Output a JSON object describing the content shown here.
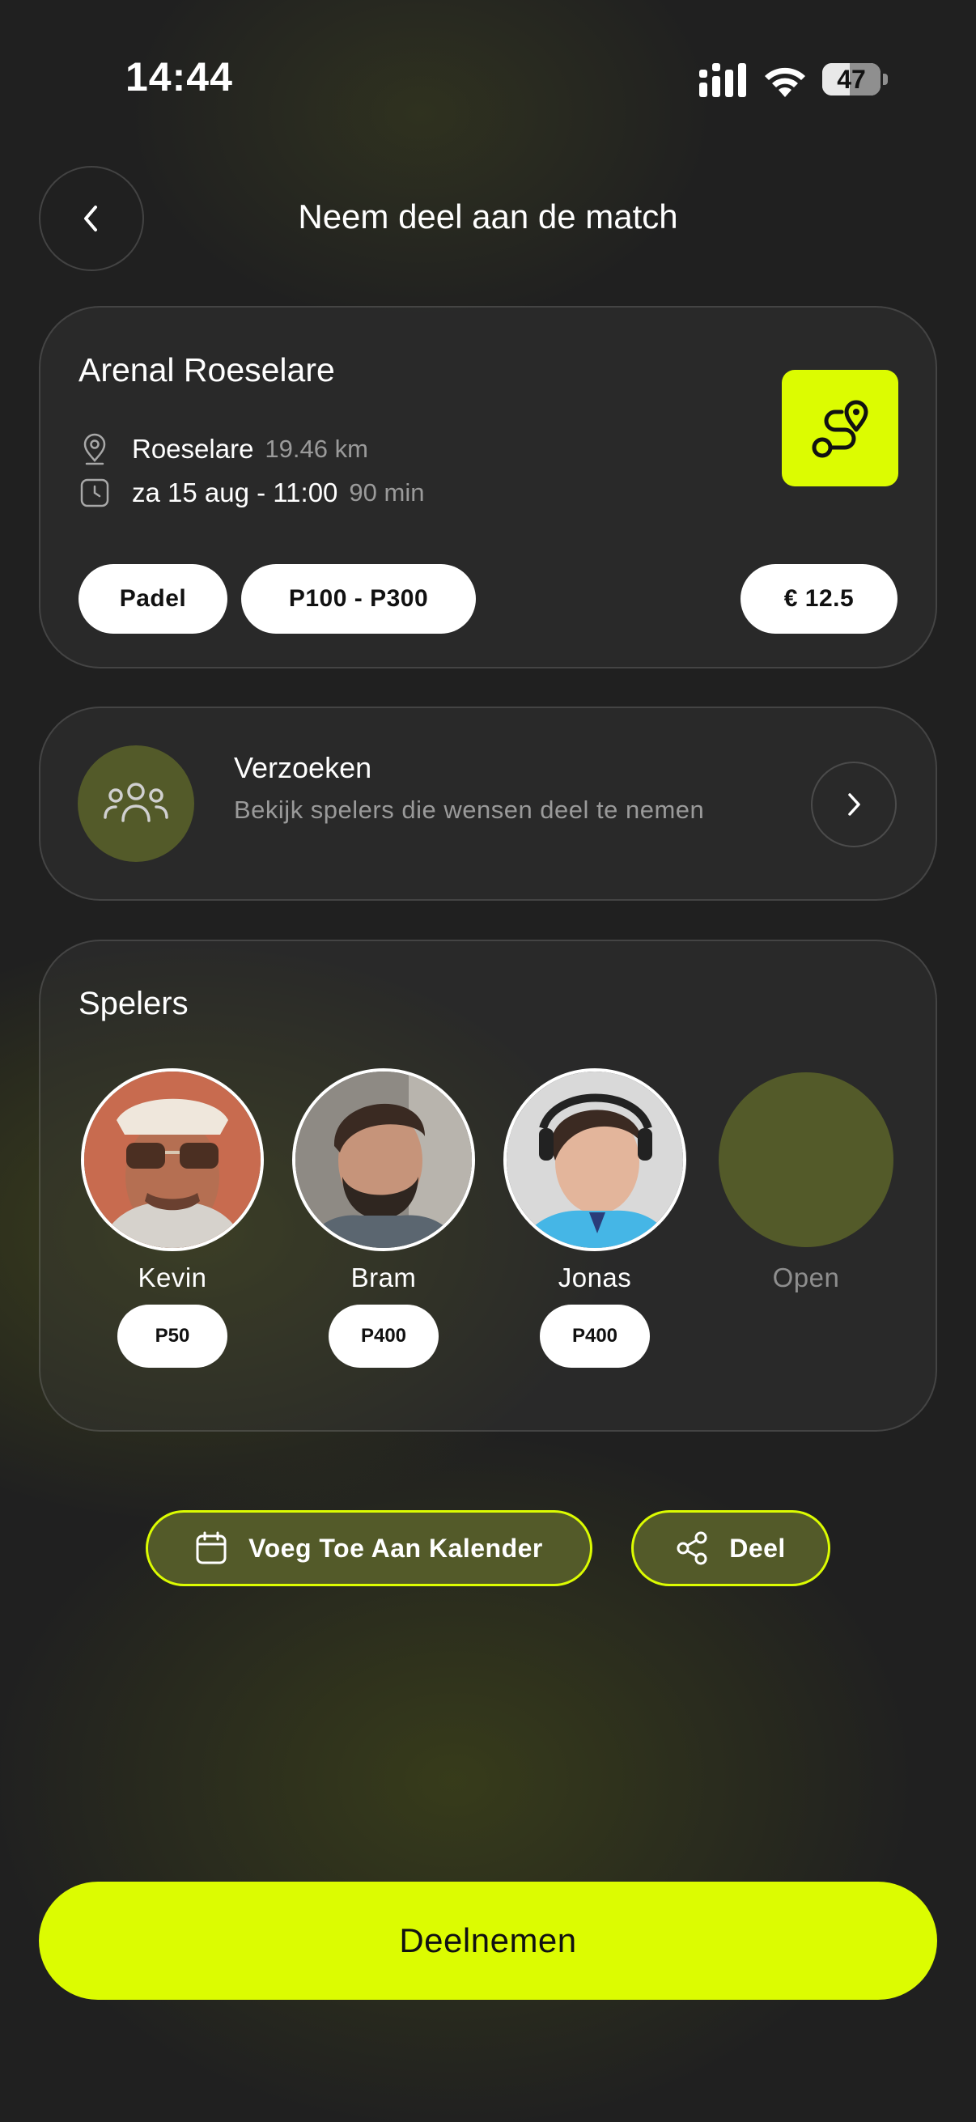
{
  "status_bar": {
    "time": "14:44",
    "battery_level": "47",
    "battery_fraction": 0.47
  },
  "header": {
    "title": "Neem deel aan de match",
    "back_icon": "chevron-left-icon"
  },
  "match": {
    "venue": "Arenal Roeselare",
    "location": "Roeselare",
    "distance": "19.46 km",
    "date_time": "za 15 aug - 11:00",
    "duration": "90 min",
    "sport": "Padel",
    "level_range": "P100 - P300",
    "price": "€ 12.5",
    "venue_icon": "route-pin-icon",
    "accent_color": "#dcfc01"
  },
  "requests": {
    "title": "Verzoeken",
    "subtitle": "Bekijk spelers die wensen deel te nemen",
    "icon": "users-icon"
  },
  "players": {
    "title": "Spelers",
    "list": [
      {
        "name": "Kevin",
        "level": "P50"
      },
      {
        "name": "Bram",
        "level": "P400"
      },
      {
        "name": "Jonas",
        "level": "P400"
      }
    ],
    "open_label": "Open"
  },
  "actions": {
    "calendar_label": "Voeg Toe Aan Kalender",
    "share_label": "Deel"
  },
  "join_label": "Deelnemen"
}
